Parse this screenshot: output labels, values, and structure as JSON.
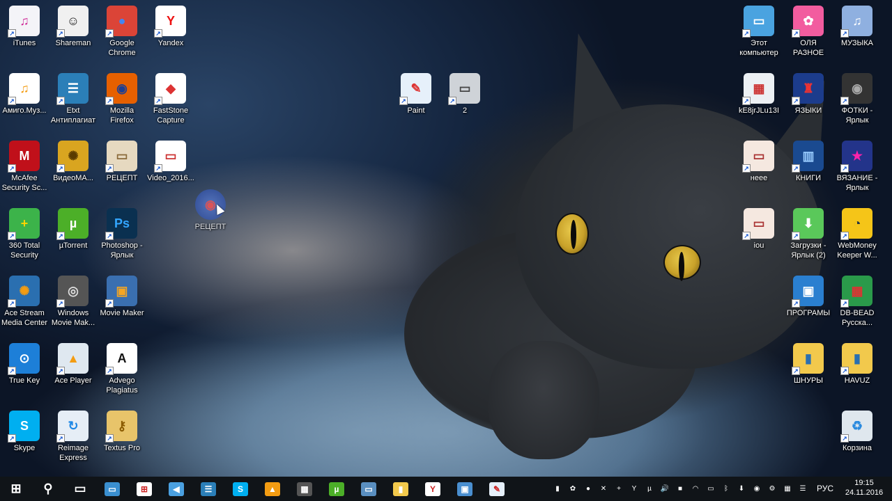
{
  "desktop": {
    "icons": [
      {
        "label": "iTunes",
        "icon": "itunes-icon",
        "color": "#f4f4f8",
        "glyph": "♫",
        "fg": "#d0309a"
      },
      {
        "label": "Shareman",
        "icon": "shareman-icon",
        "color": "#f0f0f0",
        "glyph": "☺",
        "fg": "#222"
      },
      {
        "label": "Google\nChrome",
        "icon": "chrome-icon",
        "color": "#db4437",
        "glyph": "●",
        "fg": "#4285f4"
      },
      {
        "label": "Yandex",
        "icon": "yandex-icon",
        "color": "#ffffff",
        "glyph": "Y",
        "fg": "#e11"
      },
      {
        "label": "Амиго.Муз...",
        "icon": "amigo-music-icon",
        "color": "#ffffff",
        "glyph": "♫",
        "fg": "#f39c12"
      },
      {
        "label": "Etxt\nАнтиплагиат",
        "icon": "etxt-icon",
        "color": "#2b7fb8",
        "glyph": "☰",
        "fg": "#fff"
      },
      {
        "label": "Mozilla\nFirefox",
        "icon": "firefox-icon",
        "color": "#e66000",
        "glyph": "◉",
        "fg": "#1c3f94"
      },
      {
        "label": "FastStone\nCapture",
        "icon": "faststone-icon",
        "color": "#ffffff",
        "glyph": "◆",
        "fg": "#d33"
      },
      {
        "label": "McAfee\nSecurity Sc...",
        "icon": "mcafee-icon",
        "color": "#c0101a",
        "glyph": "M",
        "fg": "#fff"
      },
      {
        "label": "ВидеоМА...",
        "icon": "videomaster-icon",
        "color": "#d9a520",
        "glyph": "✺",
        "fg": "#5a3b00"
      },
      {
        "label": "РЕЦЕПТ",
        "icon": "recipe-image-icon",
        "color": "#e6d9c0",
        "glyph": "▭",
        "fg": "#8a6a3a"
      },
      {
        "label": "Video_2016...",
        "icon": "video-file-icon",
        "color": "#ffffff",
        "glyph": "▭",
        "fg": "#c33"
      },
      {
        "label": "360 Total\nSecurity",
        "icon": "360-security-icon",
        "color": "#3cb34a",
        "glyph": "+",
        "fg": "#ffd400"
      },
      {
        "label": "µTorrent",
        "icon": "utorrent-icon",
        "color": "#4caf28",
        "glyph": "µ",
        "fg": "#fff"
      },
      {
        "label": "Photoshop -\nЯрлык",
        "icon": "photoshop-icon",
        "color": "#0a3050",
        "glyph": "Ps",
        "fg": "#33a6ff"
      },
      {
        "label": "Ace Stream\nMedia Center",
        "icon": "acestream-icon",
        "color": "#2a6fb0",
        "glyph": "✺",
        "fg": "#f39c12"
      },
      {
        "label": "Windows\nMovie Mak...",
        "icon": "movie-maker-icon",
        "color": "#555",
        "glyph": "◎",
        "fg": "#ddd"
      },
      {
        "label": "Movie Maker",
        "icon": "movie-maker-2-icon",
        "color": "#3a6fb0",
        "glyph": "▣",
        "fg": "#f5a623"
      },
      {
        "label": "True Key",
        "icon": "truekey-icon",
        "color": "#1d7fd8",
        "glyph": "⊙",
        "fg": "#fff"
      },
      {
        "label": "Ace Player",
        "icon": "aceplayer-icon",
        "color": "#dfe8f0",
        "glyph": "▲",
        "fg": "#f39c12"
      },
      {
        "label": "Advego\nPlagiatus",
        "icon": "advego-icon",
        "color": "#ffffff",
        "glyph": "A",
        "fg": "#111"
      },
      {
        "label": "Skype",
        "icon": "skype-icon",
        "color": "#00aff0",
        "glyph": "S",
        "fg": "#fff"
      },
      {
        "label": "Reimage\nExpress",
        "icon": "reimage-icon",
        "color": "#e6eef6",
        "glyph": "↻",
        "fg": "#1e88e5"
      },
      {
        "label": "Textus Pro",
        "icon": "textus-key-icon",
        "color": "#e8c46a",
        "glyph": "⚷",
        "fg": "#8a5a00"
      },
      {
        "label": "Paint",
        "icon": "paint-icon",
        "color": "#e6f0fa",
        "glyph": "✎",
        "fg": "#d33"
      },
      {
        "label": "2",
        "icon": "keyboard-icon",
        "color": "#cfd3d8",
        "glyph": "▭",
        "fg": "#444"
      },
      {
        "label": "Этот\nкомпьютер",
        "icon": "this-pc-icon",
        "color": "#4aa3e0",
        "glyph": "▭",
        "fg": "#fff"
      },
      {
        "label": "ОЛЯ\nРАЗНОЕ",
        "icon": "folder-butterfly-icon",
        "color": "#f25c9f",
        "glyph": "✿",
        "fg": "#fff"
      },
      {
        "label": "МУЗЫКА",
        "icon": "music-folder-icon",
        "color": "#8fb0e0",
        "glyph": "♫",
        "fg": "#fff"
      },
      {
        "label": "kE8jrJLu13I",
        "icon": "photo-file-icon",
        "color": "#ecf0f4",
        "glyph": "▦",
        "fg": "#c33"
      },
      {
        "label": "ЯЗЫКИ",
        "icon": "languages-folder-icon",
        "color": "#1c3c8c",
        "glyph": "♜",
        "fg": "#e33"
      },
      {
        "label": "ФОТКИ -\nЯрлык",
        "icon": "camera-icon",
        "color": "#333",
        "glyph": "◉",
        "fg": "#aaa"
      },
      {
        "label": "неее",
        "icon": "image-file-icon",
        "color": "#f5e8e0",
        "glyph": "▭",
        "fg": "#a33"
      },
      {
        "label": "КНИГИ",
        "icon": "books-icon",
        "color": "#1a4a90",
        "glyph": "▥",
        "fg": "#9cf"
      },
      {
        "label": "ВЯЗАНИЕ -\nЯрлык",
        "icon": "knitting-star-icon",
        "color": "#23348a",
        "glyph": "★",
        "fg": "#f2a"
      },
      {
        "label": "iou",
        "icon": "image-file-2-icon",
        "color": "#f5e8e0",
        "glyph": "▭",
        "fg": "#a33"
      },
      {
        "label": "Загрузки -\nЯрлык (2)",
        "icon": "downloads-icon",
        "color": "#5ac85a",
        "glyph": "⬇",
        "fg": "#fff"
      },
      {
        "label": "WebMoney\nKeeper W...",
        "icon": "webmoney-icon",
        "color": "#f5c518",
        "glyph": "◔",
        "fg": "#234"
      },
      {
        "label": "ПРОГРАМЫ",
        "icon": "programs-folder-icon",
        "color": "#2a7fd0",
        "glyph": "▣",
        "fg": "#fff"
      },
      {
        "label": "DB-BEAD\nРусска...",
        "icon": "dbbead-icon",
        "color": "#2a9a4a",
        "glyph": "▦",
        "fg": "#d33"
      },
      {
        "label": "ШНУРЫ",
        "icon": "folder-icon",
        "color": "#f2c94c",
        "glyph": "▮",
        "fg": "#2a6fb0"
      },
      {
        "label": "HAVUZ",
        "icon": "folder-2-icon",
        "color": "#f2c94c",
        "glyph": "▮",
        "fg": "#2a6fb0"
      },
      {
        "label": "Корзина",
        "icon": "recycle-bin-icon",
        "color": "#dfe7ee",
        "glyph": "♻",
        "fg": "#2a8adf"
      }
    ],
    "dragging_icon": {
      "label": "РЕЦЕПТ",
      "icon": "recipe-drag-icon"
    }
  },
  "taskbar": {
    "bg": "#101418",
    "buttons": [
      {
        "icon": "start-windows-icon",
        "color": "transparent",
        "glyph": "⊞"
      },
      {
        "icon": "search-icon",
        "color": "transparent",
        "glyph": "⚲"
      },
      {
        "icon": "task-view-icon",
        "color": "transparent",
        "glyph": "▭"
      },
      {
        "icon": "computer-icon",
        "color": "#3a8fd0",
        "glyph": "▭"
      },
      {
        "icon": "store-icon",
        "color": "#ffffff",
        "glyph": "⊞"
      },
      {
        "icon": "speaker-app-icon",
        "color": "#4aa0e0",
        "glyph": "◀"
      },
      {
        "icon": "etxt-task-icon",
        "color": "#2b7fb8",
        "glyph": "☰"
      },
      {
        "icon": "skype-task-icon",
        "color": "#00aff0",
        "glyph": "S"
      },
      {
        "icon": "aimp-icon",
        "color": "#f39c12",
        "glyph": "▲"
      },
      {
        "icon": "calculator-icon",
        "color": "#555",
        "glyph": "▦"
      },
      {
        "icon": "utorrent-task-icon",
        "color": "#4caf28",
        "glyph": "µ"
      },
      {
        "icon": "network-computer-icon",
        "color": "#5a8fc0",
        "glyph": "▭"
      },
      {
        "icon": "explorer-folder-icon",
        "color": "#f2c94c",
        "glyph": "▮"
      },
      {
        "icon": "yandex-task-icon",
        "color": "#ffffff",
        "glyph": "Y"
      },
      {
        "icon": "window-app-icon",
        "color": "#4a8fd0",
        "glyph": "▣"
      },
      {
        "icon": "paint-task-icon",
        "color": "#e6f0fa",
        "glyph": "✎"
      }
    ],
    "tray": [
      {
        "icon": "tray-flag-icon",
        "glyph": "▮"
      },
      {
        "icon": "tray-leaf-icon",
        "glyph": "✿"
      },
      {
        "icon": "tray-circle-icon",
        "glyph": "●"
      },
      {
        "icon": "tray-cross-icon",
        "glyph": "✕"
      },
      {
        "icon": "tray-plus-icon",
        "glyph": "+"
      },
      {
        "icon": "tray-yandex-icon",
        "glyph": "Y"
      },
      {
        "icon": "tray-utorrent-icon",
        "glyph": "µ"
      },
      {
        "icon": "tray-volume-icon",
        "glyph": "🔊"
      },
      {
        "icon": "tray-red-icon",
        "glyph": "■"
      },
      {
        "icon": "tray-wifi-icon",
        "glyph": "◠"
      },
      {
        "icon": "tray-battery-icon",
        "glyph": "▭"
      },
      {
        "icon": "tray-bluetooth-icon",
        "glyph": "ᛒ"
      },
      {
        "icon": "tray-download-icon",
        "glyph": "⬇"
      },
      {
        "icon": "tray-camera-icon",
        "glyph": "◉"
      },
      {
        "icon": "tray-gear-icon",
        "glyph": "⚙"
      },
      {
        "icon": "tray-keyboard-icon",
        "glyph": "▦"
      },
      {
        "icon": "tray-notification-icon",
        "glyph": "☰"
      }
    ],
    "language": "РУС",
    "time": "19:15",
    "date": "24.11.2016"
  }
}
